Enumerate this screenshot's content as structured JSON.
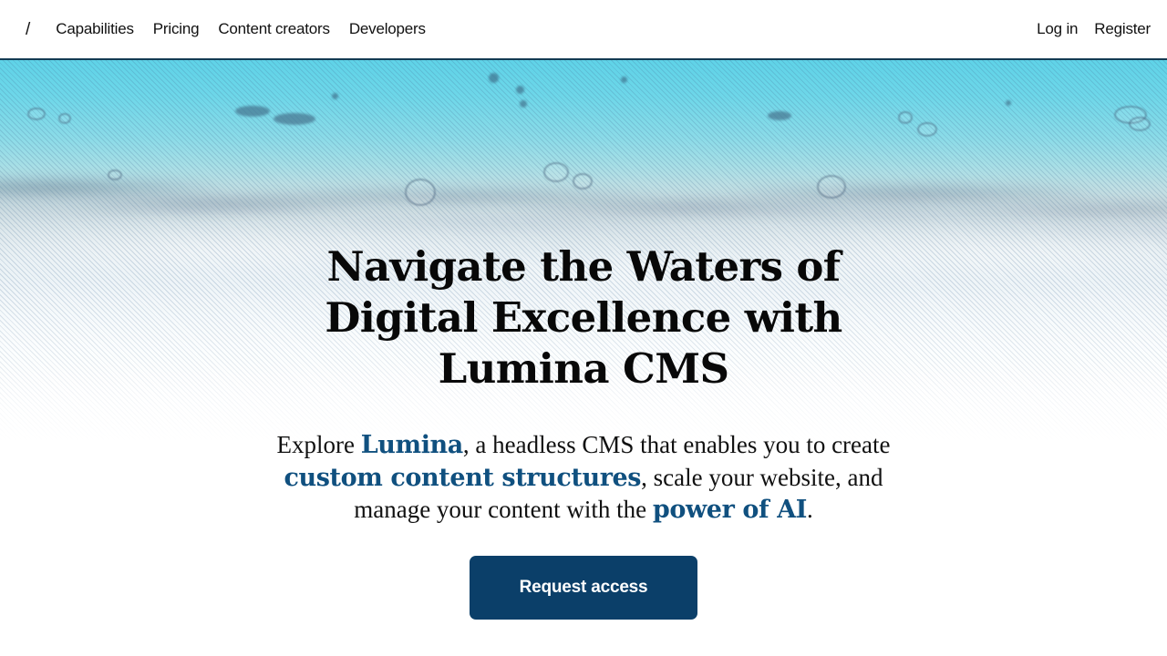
{
  "nav": {
    "logo": "/",
    "logo_icon": "slash-logo-icon",
    "links": [
      {
        "label": "Capabilities"
      },
      {
        "label": "Pricing"
      },
      {
        "label": "Content creators"
      },
      {
        "label": "Developers"
      }
    ],
    "auth": [
      {
        "label": "Log in"
      },
      {
        "label": "Register"
      }
    ]
  },
  "hero": {
    "title": "Navigate the Waters of Digital Excellence with Lumina CMS",
    "subtitle": {
      "part1": "Explore ",
      "highlight1": "Lumina",
      "part2": ", a headless CMS that enables you to create ",
      "highlight2": "custom content structures",
      "part3": ", scale your website, and manage your content with the ",
      "highlight3": "power of AI",
      "part4": "."
    },
    "cta_label": "Request access"
  },
  "colors": {
    "accent_blue": "#10507f",
    "button_bg": "#0b3f69",
    "button_text": "#ffffff",
    "nav_text": "#111111",
    "heading_text": "#080808",
    "water_top": "#5fd3e8",
    "water_bottom": "#ffffff",
    "nav_border": "#123a52"
  }
}
